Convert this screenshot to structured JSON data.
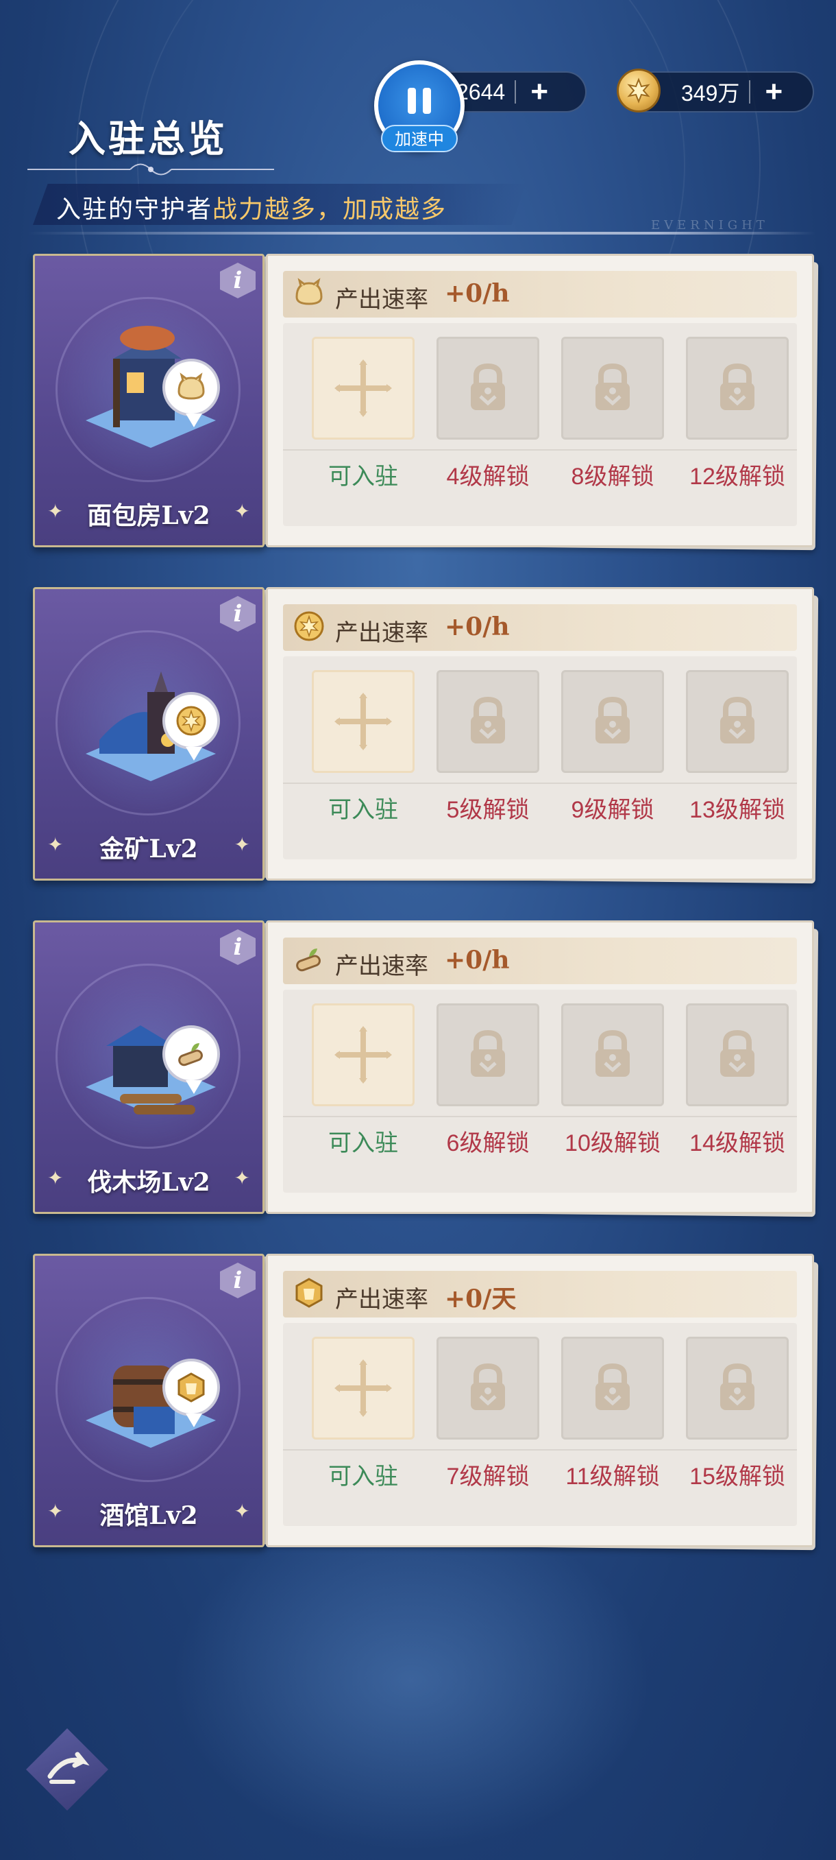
{
  "header": {
    "title": "入驻总览",
    "subtitle_prefix": "入驻的守护者",
    "subtitle_highlight": "战力越多，加成越多",
    "watermark": "EVERNIGHT"
  },
  "currency": [
    {
      "value": "2644",
      "icon": "power-icon",
      "plus": "+"
    },
    {
      "value": "349万",
      "icon": "gold-coin-icon",
      "plus": "+"
    }
  ],
  "speed": {
    "label": "加速中",
    "icon": "pause-icon"
  },
  "colors": {
    "open": "#3c8a58",
    "locked": "#b13848",
    "rate": "#a5592b",
    "card_left": "#55488e"
  },
  "buildings": [
    {
      "name": "面包房Lv2",
      "resource_icon": "bread-icon",
      "rate_label": "产出速率",
      "rate_value": "+0/h",
      "slots": [
        {
          "state": "open",
          "caption": "可入驻"
        },
        {
          "state": "locked",
          "caption": "4级解锁"
        },
        {
          "state": "locked",
          "caption": "8级解锁"
        },
        {
          "state": "locked",
          "caption": "12级解锁"
        }
      ]
    },
    {
      "name": "金矿Lv2",
      "resource_icon": "gold-coin-icon",
      "rate_label": "产出速率",
      "rate_value": "+0/h",
      "slots": [
        {
          "state": "open",
          "caption": "可入驻"
        },
        {
          "state": "locked",
          "caption": "5级解锁"
        },
        {
          "state": "locked",
          "caption": "9级解锁"
        },
        {
          "state": "locked",
          "caption": "13级解锁"
        }
      ]
    },
    {
      "name": "伐木场Lv2",
      "resource_icon": "wood-log-icon",
      "rate_label": "产出速率",
      "rate_value": "+0/h",
      "slots": [
        {
          "state": "open",
          "caption": "可入驻"
        },
        {
          "state": "locked",
          "caption": "6级解锁"
        },
        {
          "state": "locked",
          "caption": "10级解锁"
        },
        {
          "state": "locked",
          "caption": "14级解锁"
        }
      ]
    },
    {
      "name": "酒馆Lv2",
      "resource_icon": "tavern-badge-icon",
      "rate_label": "产出速率",
      "rate_value": "+0/天",
      "slots": [
        {
          "state": "open",
          "caption": "可入驻"
        },
        {
          "state": "locked",
          "caption": "7级解锁"
        },
        {
          "state": "locked",
          "caption": "11级解锁"
        },
        {
          "state": "locked",
          "caption": "15级解锁"
        }
      ]
    }
  ],
  "footer": {
    "nav_icon": "return-arrow-icon"
  }
}
